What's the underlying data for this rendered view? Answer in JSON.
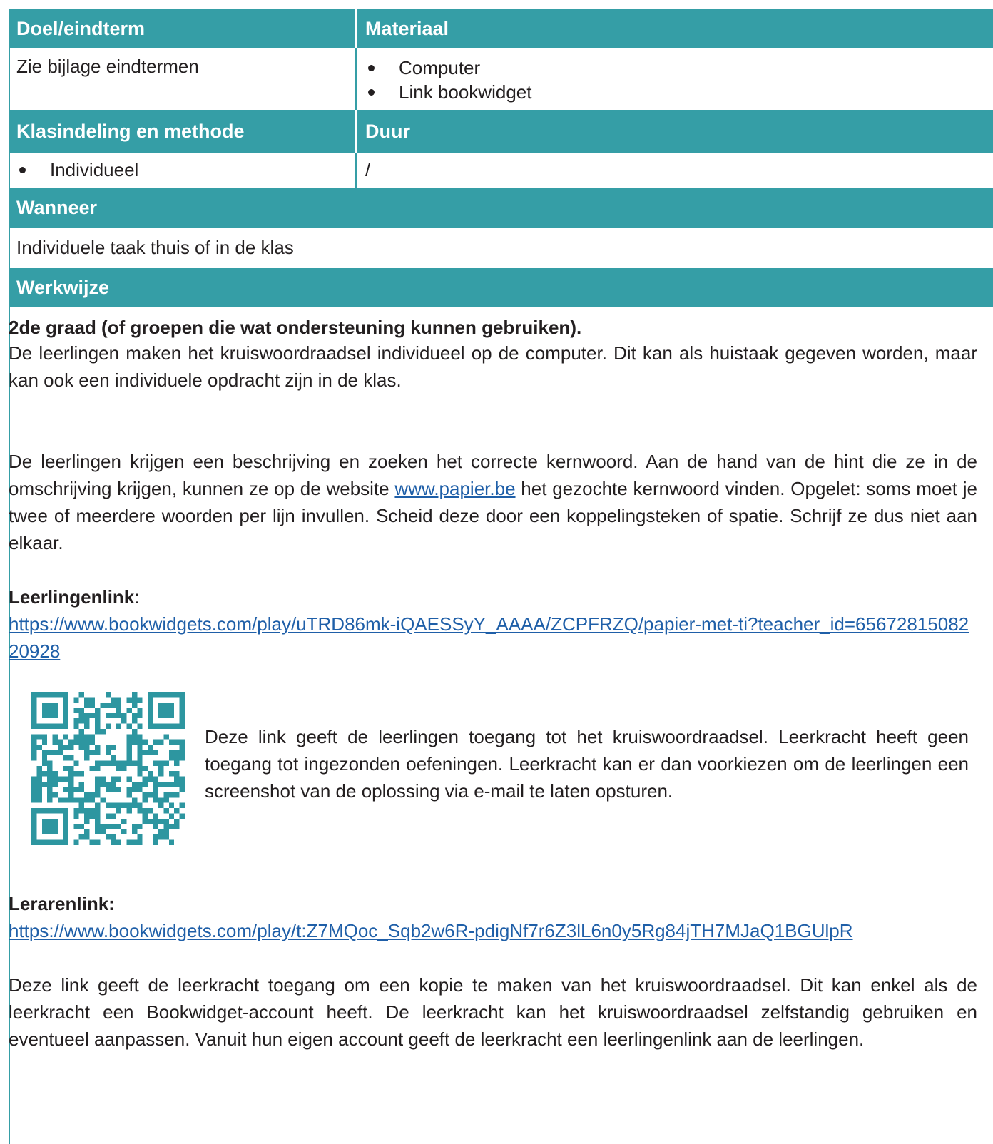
{
  "table": {
    "doel_header": "Doel/eindterm",
    "materiaal_header": "Materiaal",
    "doel_value": "Zie bijlage eindtermen",
    "materiaal_items": [
      "Computer",
      "Link bookwidget"
    ],
    "klas_header": "Klasindeling en methode",
    "duur_header": "Duur",
    "klas_items": [
      "Individueel"
    ],
    "duur_value": "/",
    "wanneer_header": "Wanneer",
    "wanneer_value": "Individuele taak thuis of in de klas",
    "werkwijze_header": "Werkwijze"
  },
  "werkwijze": {
    "graad_title": "2de graad (of groepen die wat ondersteuning kunnen gebruiken).",
    "p1": "De leerlingen maken het kruiswoordraadsel individueel op de computer. Dit kan als huistaak gegeven worden, maar kan ook een individuele opdracht zijn in de klas.",
    "p2_before": "De leerlingen krijgen een beschrijving en zoeken het correcte kernwoord. Aan de hand van de hint die ze in de omschrijving krijgen, kunnen ze op de website ",
    "p2_link": "www.papier.be",
    "p2_after": " het gezochte kernwoord vinden. Opgelet: soms moet je twee of meerdere woorden per lijn invullen. Scheid deze door een koppelingsteken of spatie. Schrijf ze dus niet aan elkaar.",
    "leerlingenlink_label": "Leerlingenlink",
    "leerlingenlink_colon": ":",
    "leerlingenlink_url": "https://www.bookwidgets.com/play/uTRD86mk-iQAESSyY_AAAA/ZCPFRZQ/papier-met-ti?teacher_id=6567281508220928",
    "qr_caption": "Deze link geeft de leerlingen toegang tot het kruiswoordraadsel. Leerkracht heeft geen toegang tot ingezonden oefeningen. Leerkracht kan er dan voorkiezen om de leerlingen een screenshot van de oplossing via e-mail te laten opsturen.",
    "lerarenlink_label": "Lerarenlink:",
    "lerarenlink_url": "https://www.bookwidgets.com/play/t:Z7MQoc_Sqb2w6R-pdigNf7r6Z3lL6n0y5Rg84jTH7MJaQ1BGUlpR",
    "p_last": "Deze link geeft de leerkracht toegang om een kopie te maken van het kruiswoordraadsel. Dit kan enkel als de leerkracht een Bookwidget-account heeft. De leerkracht kan het kruiswoordraadsel zelfstandig gebruiken en eventueel aanpassen. Vanuit hun eigen account geeft de leerkracht een leerlingenlink aan de leerlingen."
  },
  "colors": {
    "accent": "#359ea6",
    "link": "#1f5fa8",
    "text": "#231f20"
  }
}
